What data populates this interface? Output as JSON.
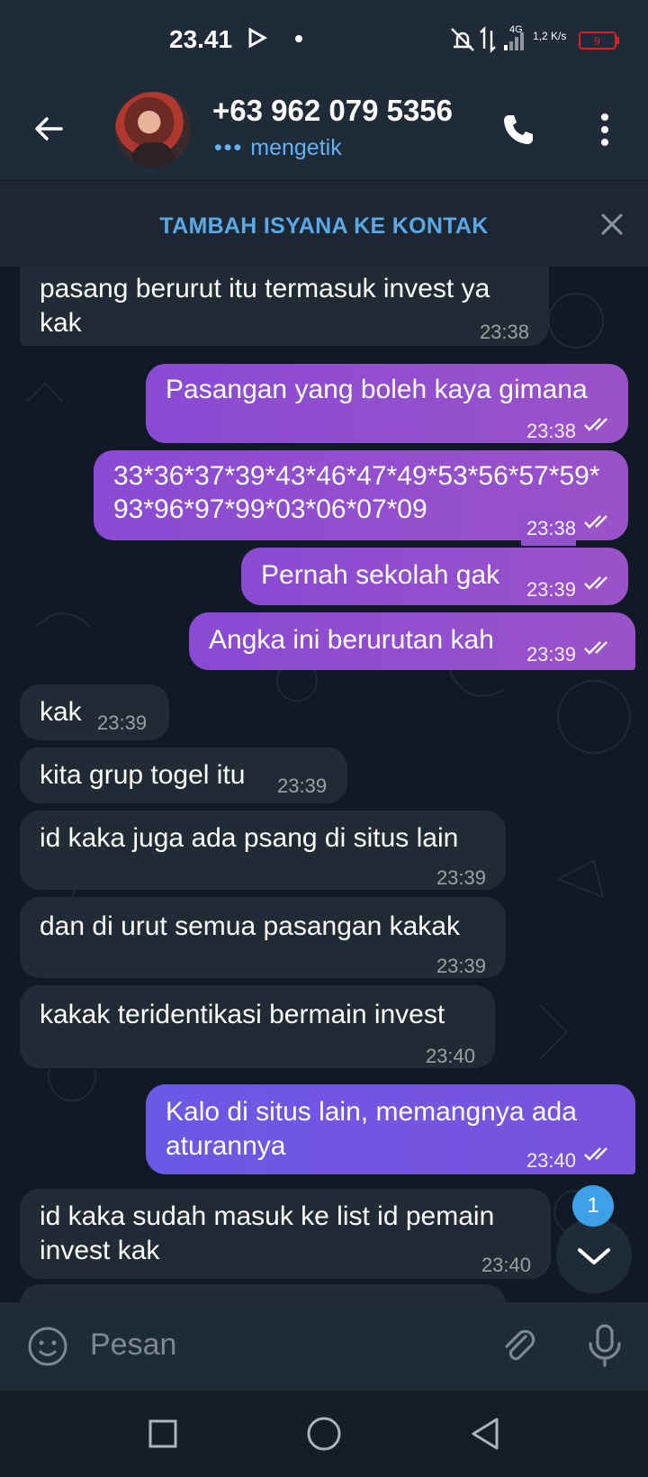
{
  "status_bar": {
    "time": "23.41",
    "network": "4G",
    "speed": "1,2 K/s",
    "battery": "9"
  },
  "header": {
    "title": "+63 962 079 5356",
    "subtitle": "mengetik"
  },
  "banner": {
    "text": "TAMBAH ISYANA KE KONTAK"
  },
  "messages": [
    {
      "dir": "in",
      "text": "pasang berurut itu termasuk invest ya kak",
      "time": "23:38"
    },
    {
      "dir": "out",
      "text": "Pasangan yang boleh kaya gimana",
      "time": "23:38"
    },
    {
      "dir": "out",
      "text": "33*36*37*39*43*46*47*49*53*56*57*59*93*96*97*99*03*06*07*09",
      "time": "23:38"
    },
    {
      "dir": "out",
      "text": "Pernah sekolah gak",
      "time": "23:39"
    },
    {
      "dir": "out",
      "text": "Angka ini berurutan kah",
      "time": "23:39"
    },
    {
      "dir": "in",
      "text": "kak",
      "time": "23:39"
    },
    {
      "dir": "in",
      "text": "kita grup togel itu",
      "time": "23:39"
    },
    {
      "dir": "in",
      "text": "id kaka juga ada psang di situs lain",
      "time": "23:39"
    },
    {
      "dir": "in",
      "text": "dan di urut semua pasangan kakak",
      "time": "23:39"
    },
    {
      "dir": "in",
      "text": "kakak teridentikasi bermain invest",
      "time": "23:40"
    },
    {
      "dir": "out",
      "text": "Kalo di situs lain, memangnya ada aturannya",
      "time": "23:40"
    },
    {
      "dir": "in",
      "text": "id kaka sudah masuk ke list id pemain invest kak",
      "time": "23:40"
    }
  ],
  "scroll_badge": "1",
  "input": {
    "placeholder": "Pesan"
  },
  "colors": {
    "header_bg": "#1f2b38",
    "accent": "#5aa9e6",
    "out_bubble": "#8a4ad3",
    "in_bubble": "#202b36"
  }
}
